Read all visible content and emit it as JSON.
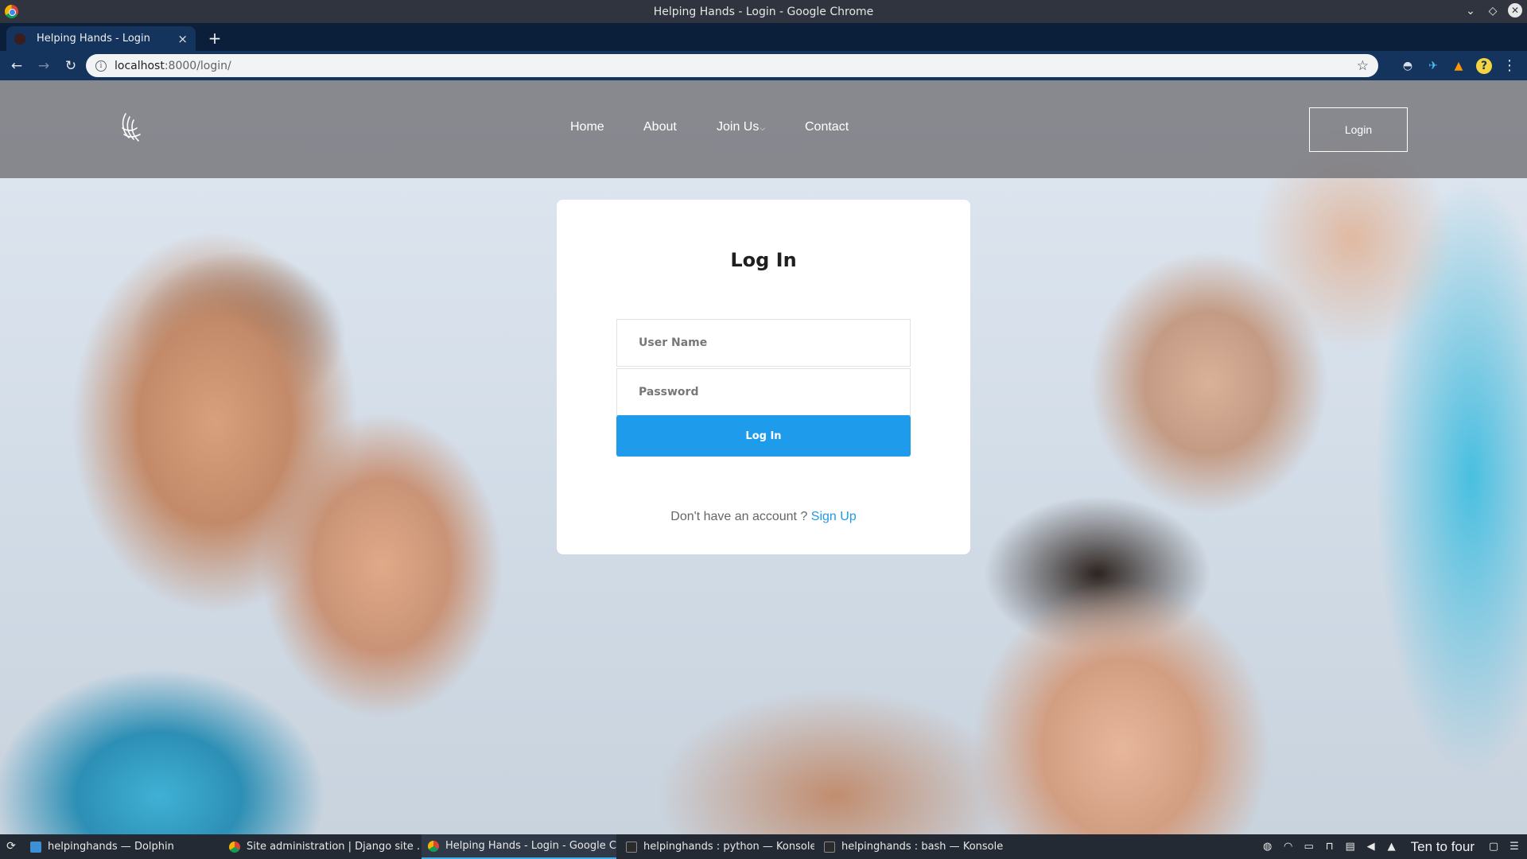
{
  "window": {
    "title": "Helping Hands - Login - Google Chrome"
  },
  "browser": {
    "tab_title": "Helping Hands - Login",
    "tab_close": "×",
    "new_tab": "+",
    "url_host": "localhost",
    "url_path": ":8000/login/"
  },
  "site": {
    "nav": {
      "home": "Home",
      "about": "About",
      "join_us": "Join Us",
      "join_us_caret": "⌵",
      "contact": "Contact",
      "login_button": "Login"
    },
    "login": {
      "title": "Log In",
      "username_placeholder": "User Name",
      "password_placeholder": "Password",
      "submit": "Log In",
      "signup_prompt": "Don't have an account ? ",
      "signup_link": "Sign Up"
    },
    "colors": {
      "primary": "#1e9bea",
      "navbar_overlay": "rgba(110,110,115,0.78)"
    }
  },
  "taskbar": {
    "tasks": [
      "helpinghands — Dolphin",
      "Site administration | Django site ...",
      "Helping Hands - Login - Google C...",
      "helpinghands : python — Konsole",
      "helpinghands : bash — Konsole"
    ],
    "clock": "Ten to four"
  }
}
